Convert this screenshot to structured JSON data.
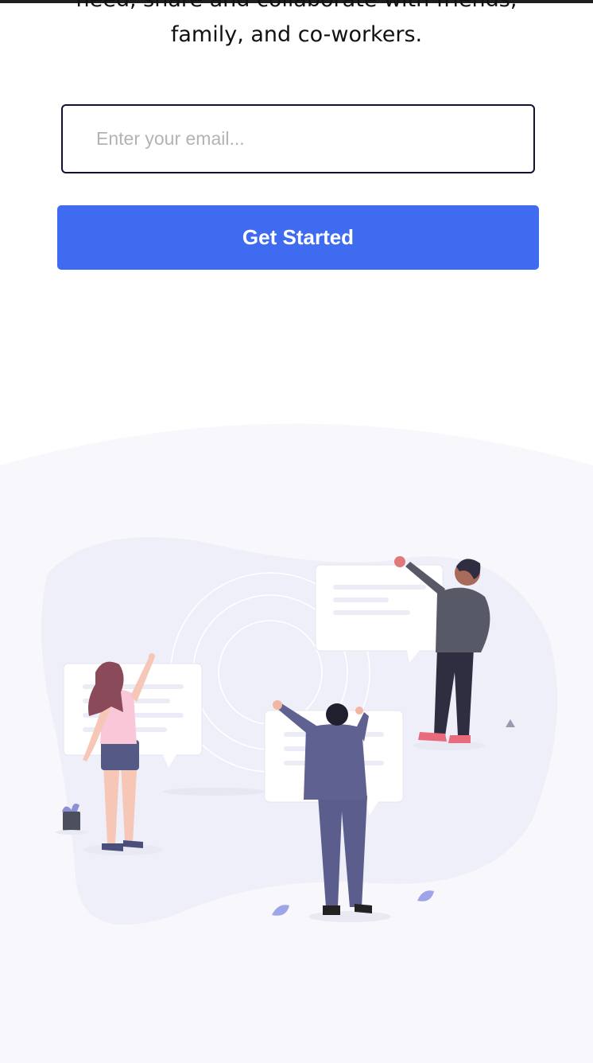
{
  "hero": {
    "intro_line_1": "need, share and collaborate with friends,",
    "intro_line_2": "family, and co-workers."
  },
  "signup": {
    "email_placeholder": "Enter your email...",
    "cta_label": "Get Started"
  },
  "colors": {
    "accent": "#3e6bf0",
    "input_border": "#111133",
    "section_bg": "#f7f7fc"
  }
}
